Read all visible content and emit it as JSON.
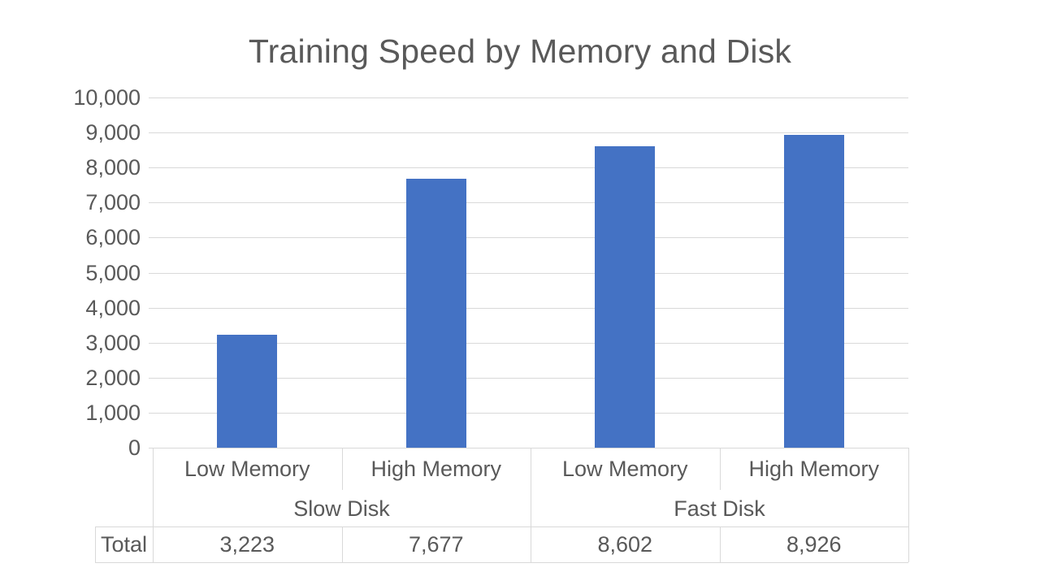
{
  "chart_data": {
    "type": "bar",
    "title": "Training Speed by Memory and Disk",
    "xlabel": "",
    "ylabel": "",
    "categories": [
      "Low Memory",
      "High Memory",
      "Low Memory",
      "High Memory"
    ],
    "groups": [
      {
        "label": "Slow Disk",
        "span": 2
      },
      {
        "label": "Fast Disk",
        "span": 2
      }
    ],
    "values": [
      3223,
      7677,
      8602,
      8926
    ],
    "value_labels": [
      "3,223",
      "7,677",
      "8,602",
      "8,926"
    ],
    "series": [
      {
        "name": "Total",
        "values": [
          3223,
          7677,
          8602,
          8926
        ],
        "color": "#4472C4"
      }
    ],
    "ylim": [
      0,
      10000
    ],
    "ytick_step": 1000,
    "ytick_labels": [
      "10,000",
      "9,000",
      "8,000",
      "7,000",
      "6,000",
      "5,000",
      "4,000",
      "3,000",
      "2,000",
      "1,000",
      "0"
    ],
    "ytick_values": [
      10000,
      9000,
      8000,
      7000,
      6000,
      5000,
      4000,
      3000,
      2000,
      1000,
      0
    ],
    "grid": true,
    "legend": false,
    "data_table": {
      "visible": true,
      "row_header": "Total",
      "row_values": [
        "3,223",
        "7,677",
        "8,602",
        "8,926"
      ]
    },
    "colors": {
      "bar": "#4472C4",
      "text": "#595959",
      "gridline": "#D9D9D9",
      "background": "#FFFFFF",
      "table_border": "#D9D9D9"
    }
  }
}
